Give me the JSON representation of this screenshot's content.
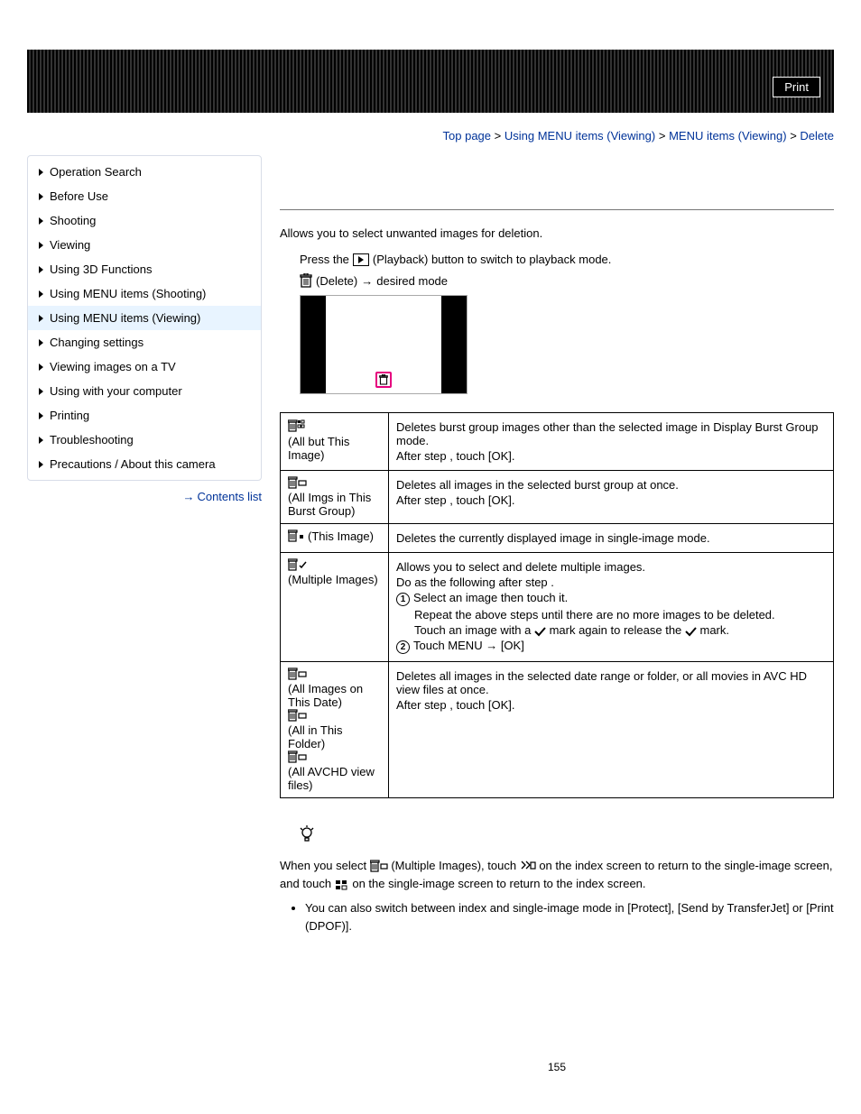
{
  "header": {
    "print_label": "Print"
  },
  "breadcrumb": {
    "top_page": "Top page",
    "cat1": "Using MENU items (Viewing)",
    "cat2": "MENU items (Viewing)",
    "current": "Delete"
  },
  "sidebar": {
    "items": [
      "Operation Search",
      "Before Use",
      "Shooting",
      "Viewing",
      "Using 3D Functions",
      "Using MENU items (Shooting)",
      "Using MENU items (Viewing)",
      "Changing settings",
      "Viewing images on a TV",
      "Using with your computer",
      "Printing",
      "Troubleshooting",
      "Precautions / About this camera"
    ],
    "active_index": 6,
    "contents_list": "Contents list"
  },
  "main": {
    "intro": "Allows you to select unwanted images for deletion.",
    "step1a": "Press the ",
    "step1b": "(Playback) button to switch to playback mode.",
    "step2a": "(Delete) ",
    "step2b": " desired mode",
    "table": {
      "rows": [
        {
          "label": "(All but This Image)",
          "desc": [
            "Deletes burst group images other than the selected image in Display Burst Group mode.",
            "After step   , touch [OK]."
          ]
        },
        {
          "label": "(All Imgs in This Burst Group)",
          "desc": [
            "Deletes all images in the selected burst group at once.",
            "After step   , touch [OK]."
          ]
        },
        {
          "label": "(This Image)",
          "desc": [
            "Deletes the currently displayed image in single-image mode."
          ]
        },
        {
          "label": " (Multiple Images)",
          "desc_multi": {
            "p1": "Allows you to select and delete multiple images.",
            "p2": "Do as the following after step   .",
            "s1a": "Select an image then touch it.",
            "s1b": "Repeat the above steps until there are no more images to be deleted.",
            "s1c_a": "Touch an image with a ",
            "s1c_b": " mark again to release the ",
            "s1c_c": " mark.",
            "s2": "Touch MENU ",
            "s2b": " [OK]"
          }
        },
        {
          "label_multi": [
            "(All Images on This Date)",
            "(All in This Folder)",
            "(All AVCHD view files)"
          ],
          "desc": [
            "Deletes all images in the selected date range or folder, or all movies in AVC HD view files at once.",
            "After step   , touch [OK]."
          ]
        }
      ]
    },
    "tips": {
      "p1a": "When you select ",
      "p1b": "(Multiple Images), touch ",
      "p1c": "on the index screen to return to the single-image screen, and touch ",
      "p1d": "on the single-image screen to return to the index screen.",
      "bullet": "You can also switch between index and single-image mode in [Protect], [Send by TransferJet] or [Print (DPOF)]."
    }
  },
  "page_number": "155"
}
